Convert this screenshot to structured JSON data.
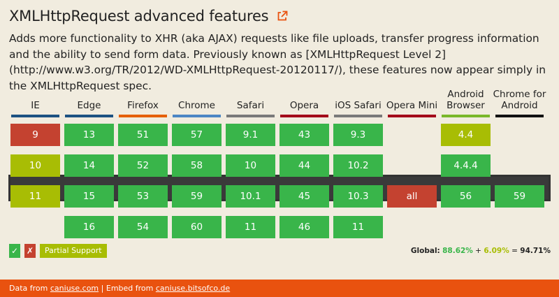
{
  "title": "XMLHttpRequest advanced features",
  "description": "Adds more functionality to XHR (aka AJAX) requests like file uploads, transfer progress information and the ability to send form data. Previously known as [XMLHttpRequest Level 2](http://www.w3.org/TR/2012/WD-XMLHttpRequest-20120117/), these features now appear simply in the XMLHttpRequest spec.",
  "browsers": [
    {
      "name": "IE",
      "color": "#1d5282"
    },
    {
      "name": "Edge",
      "color": "#1d5282"
    },
    {
      "name": "Firefox",
      "color": "#e66000"
    },
    {
      "name": "Chrome",
      "color": "#4c86c4"
    },
    {
      "name": "Safari",
      "color": "#7a7a7a"
    },
    {
      "name": "Opera",
      "color": "#a3001a"
    },
    {
      "name": "iOS Safari",
      "color": "#7a7a7a"
    },
    {
      "name": "Opera Mini",
      "color": "#a3001a"
    },
    {
      "name": "Android Browser",
      "color": "#7ab82a"
    },
    {
      "name": "Chrome for Android",
      "color": "#111111"
    }
  ],
  "rows": [
    [
      {
        "v": "9",
        "s": "n"
      },
      {
        "v": "13",
        "s": "y"
      },
      {
        "v": "51",
        "s": "y"
      },
      {
        "v": "57",
        "s": "y"
      },
      {
        "v": "9.1",
        "s": "y"
      },
      {
        "v": "43",
        "s": "y"
      },
      {
        "v": "9.3",
        "s": "y"
      },
      {
        "v": "",
        "s": "empty"
      },
      {
        "v": "4.4",
        "s": "a"
      },
      {
        "v": "",
        "s": "empty"
      }
    ],
    [
      {
        "v": "10",
        "s": "a"
      },
      {
        "v": "14",
        "s": "y"
      },
      {
        "v": "52",
        "s": "y"
      },
      {
        "v": "58",
        "s": "y"
      },
      {
        "v": "10",
        "s": "y"
      },
      {
        "v": "44",
        "s": "y"
      },
      {
        "v": "10.2",
        "s": "y"
      },
      {
        "v": "",
        "s": "empty"
      },
      {
        "v": "4.4.4",
        "s": "y"
      },
      {
        "v": "",
        "s": "empty"
      }
    ],
    [
      {
        "v": "11",
        "s": "a"
      },
      {
        "v": "15",
        "s": "y"
      },
      {
        "v": "53",
        "s": "y"
      },
      {
        "v": "59",
        "s": "y"
      },
      {
        "v": "10.1",
        "s": "y"
      },
      {
        "v": "45",
        "s": "y"
      },
      {
        "v": "10.3",
        "s": "y"
      },
      {
        "v": "all",
        "s": "n"
      },
      {
        "v": "56",
        "s": "y"
      },
      {
        "v": "59",
        "s": "y"
      }
    ],
    [
      {
        "v": "",
        "s": "empty"
      },
      {
        "v": "16",
        "s": "y"
      },
      {
        "v": "54",
        "s": "y"
      },
      {
        "v": "60",
        "s": "y"
      },
      {
        "v": "11",
        "s": "y"
      },
      {
        "v": "46",
        "s": "y"
      },
      {
        "v": "11",
        "s": "y"
      },
      {
        "v": "",
        "s": "empty"
      },
      {
        "v": "",
        "s": "empty"
      },
      {
        "v": "",
        "s": "empty"
      }
    ]
  ],
  "legend": {
    "supported": "✓",
    "unsupported": "✗",
    "partial": "Partial Support"
  },
  "global": {
    "label": "Global:",
    "full": "88.62%",
    "plus": "+",
    "partial": "6.09%",
    "equals": "=",
    "total": "94.71%"
  },
  "footer": {
    "data_prefix": "Data from",
    "data_link": "caniuse.com",
    "separator": "|",
    "embed_prefix": "Embed from",
    "embed_link": "caniuse.bitsofco.de"
  }
}
